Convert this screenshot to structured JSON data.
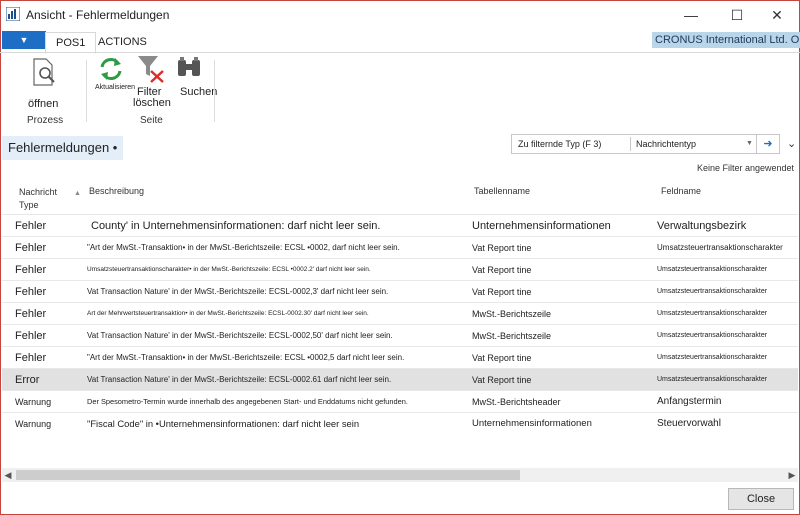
{
  "window": {
    "title": "Ansicht - Fehlermeldungen"
  },
  "ribbon": {
    "tabs": [
      "POS1",
      "ACTIONS"
    ],
    "company": "CRONUS International Ltd. O",
    "open_label": "öffnen",
    "group_process": "Prozess",
    "refresh_label": "Aktualisieren",
    "filter_label1": "Filter",
    "filter_label2": "löschen",
    "search_label": "Suchen",
    "group_page": "Seite"
  },
  "page": {
    "title": "Fehlermeldungen •",
    "filter_field": "Zu filternde Typ (F 3)",
    "filter_value": "Nachrichtentyp",
    "no_filters": "Keine Filter angewendet"
  },
  "table": {
    "headers": [
      "Nachricht Type",
      "Beschreibung",
      "Tabellenname",
      "Feldname"
    ],
    "rows": [
      {
        "type": "Fehler",
        "desc": "County' in Unternehmensinformationen: darf nicht leer sein.",
        "table": "Unternehmensinformationen",
        "field": "Verwaltungsbezirk"
      },
      {
        "type": "Fehler",
        "desc": "\"Art der MwSt.-Transaktion• in der MwSt.-Berichtszeile: ECSL •0002, darf nicht leer sein.",
        "table": "Vat Report tine",
        "field": "Umsatzsteuertransaktionscharakter"
      },
      {
        "type": "Fehler",
        "desc": "Umsatzsteuertransaktionscharakter• in der MwSt.-Berichtszeile: ECSL •0002.2' darf nicht leer sein.",
        "table": "Vat Report tine",
        "field": "Umsatzsteuertransaktionscharakter"
      },
      {
        "type": "Fehler",
        "desc": "Vat Transaction Nature' in der MwSt.-Berichtszeile: ECSL-0002,3' darf nicht leer sein.",
        "table": "Vat Report tine",
        "field": "Umsatzsteuertransaktionscharakter"
      },
      {
        "type": "Fehler",
        "desc": "Art der Mehrwertsteuertransaktion• in der MwSt.-Berichtszeile: ECSL-0002.30' darf nicht leer sein.",
        "table": "MwSt.-Berichtszeile",
        "field": "Umsatzsteuertransaktionscharakter"
      },
      {
        "type": "Fehler",
        "desc": "Vat Transaction Nature' in der MwSt.-Berichtszeile: ECSL-0002,50' darf nicht leer sein.",
        "table": "MwSt.-Berichtszeile",
        "field": "Umsatzsteuertransaktionscharakter"
      },
      {
        "type": "Fehler",
        "desc": "\"Art der MwSt.-Transaktion• in der MwSt.-Berichtszeile: ECSL •0002,5 darf nicht leer sein.",
        "table": "Vat Report tine",
        "field": "Umsatzsteuertransaktionscharakter"
      },
      {
        "type": "Error",
        "desc": "Vat Transaction Nature' in der MwSt.-Berichtszeile: ECSL-0002.61 darf nicht leer sein.",
        "table": "Vat Report tine",
        "field": "Umsatzsteuertransaktionscharakter"
      },
      {
        "type": "Warnung",
        "desc": "Der Spesometro-Termin wurde innerhalb des angegebenen Start- und Enddatums nicht gefunden.",
        "table": "MwSt.-Berichtsheader",
        "field": "Anfangstermin"
      },
      {
        "type": "Warnung",
        "desc": "\"Fiscal Code\" in •Unternehmensinformationen: darf nicht leer sein",
        "table": "Unternehmensinformationen",
        "field": "Steuervorwahl"
      }
    ]
  },
  "footer": {
    "close_label": "Close"
  },
  "colors": {
    "accent": "#1e6ec6",
    "company_bg": "#b9d5ea",
    "border": "#c6443f"
  }
}
